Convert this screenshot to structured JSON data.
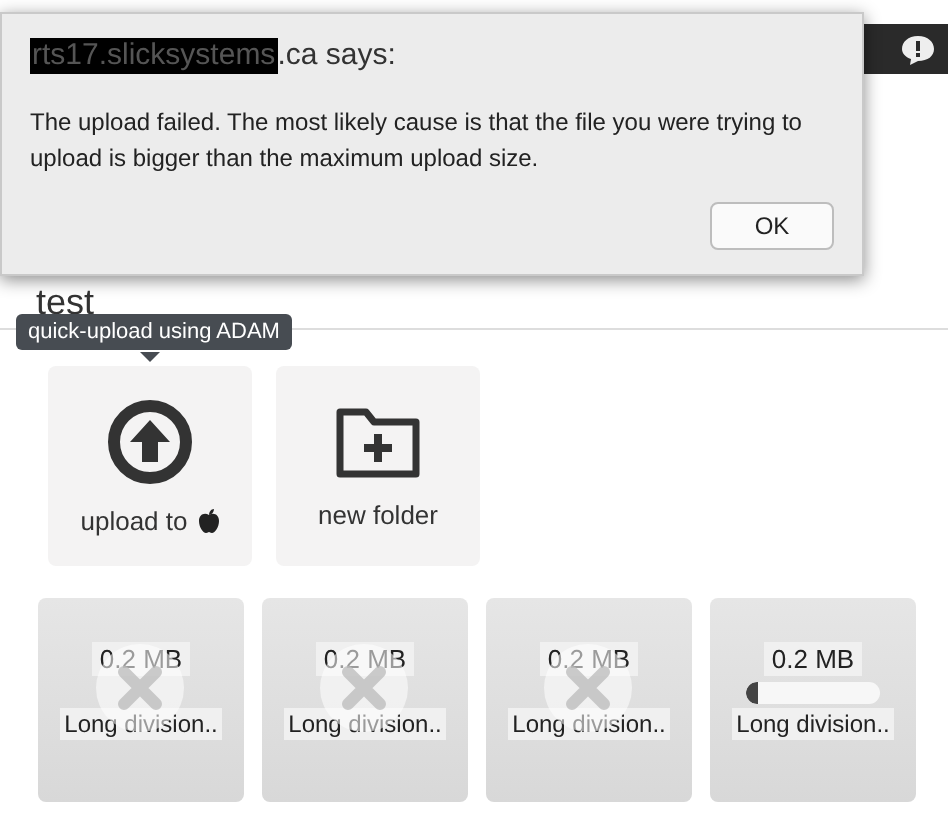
{
  "dialog": {
    "redacted_host": "rts17.slicksystems",
    "title": ".ca says:",
    "message": "The upload failed. The most likely cause is that the file you were trying to upload is bigger than the maximum upload size.",
    "buttons": [
      "OK"
    ]
  },
  "heading": "test",
  "tooltip": "quick-upload using ADAM",
  "actions": [
    {
      "kind": "upload",
      "label": "upload to"
    },
    {
      "kind": "folder",
      "label": "new folder"
    }
  ],
  "uploads": [
    {
      "kind": "failed",
      "size": "0.2 MB",
      "name": "Long division.."
    },
    {
      "kind": "failed",
      "size": "0.2 MB",
      "name": "Long division.."
    },
    {
      "kind": "failed",
      "size": "0.2 MB",
      "name": "Long division.."
    },
    {
      "kind": "progress",
      "size": "0.2 MB",
      "name": "Long division..",
      "level": 0.05
    }
  ]
}
